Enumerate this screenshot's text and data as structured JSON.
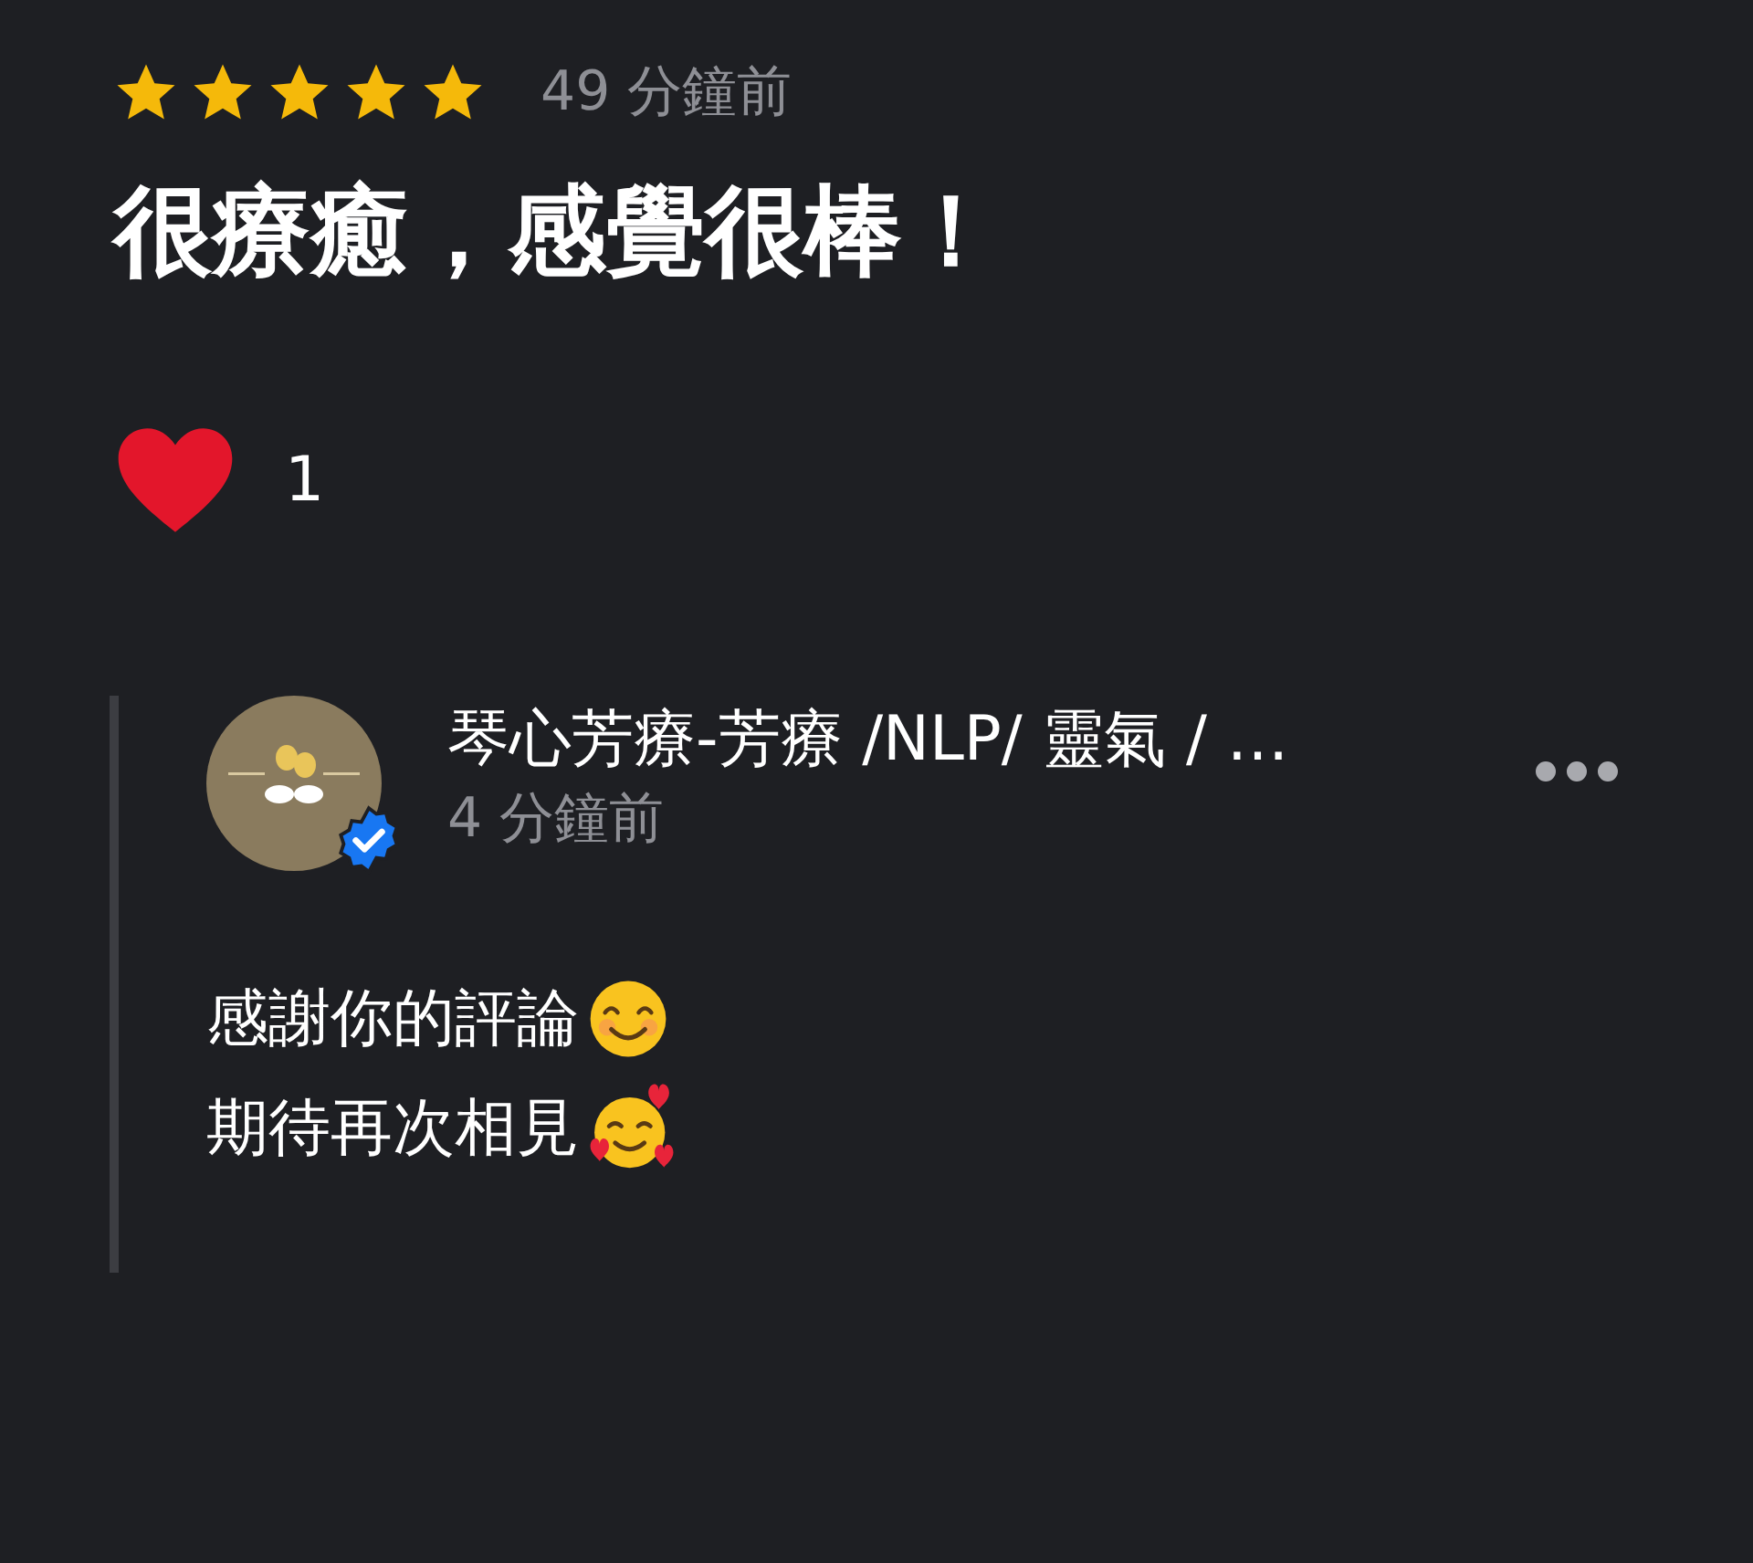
{
  "review": {
    "stars": 5,
    "time": "49 分鐘前",
    "text": "很療癒，感覺很棒！",
    "reactions": {
      "count": "1"
    }
  },
  "reply": {
    "author": "琴心芳療-芳療 /NLP/ 靈氣 / …",
    "verified": true,
    "time": "4 分鐘前",
    "lines": [
      "感謝你的評論",
      "期待再次相見"
    ]
  }
}
